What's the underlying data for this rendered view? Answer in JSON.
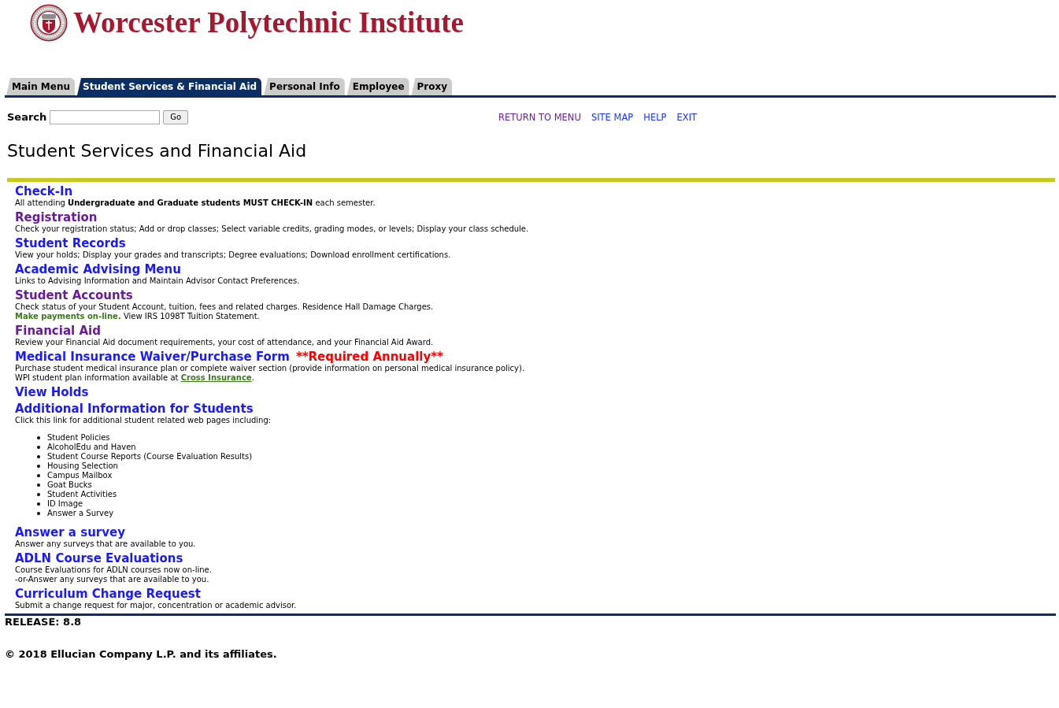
{
  "header": {
    "title": "Worcester Polytechnic Institute"
  },
  "tabs": [
    {
      "label": "Main Menu",
      "selected": false
    },
    {
      "label": "Student Services & Financial Aid",
      "selected": true
    },
    {
      "label": "Personal Info",
      "selected": false
    },
    {
      "label": "Employee",
      "selected": false
    },
    {
      "label": "Proxy",
      "selected": false
    }
  ],
  "search": {
    "label": "Search",
    "button": "Go"
  },
  "top_links": [
    {
      "label": "RETURN TO MENU",
      "visited": true
    },
    {
      "label": "SITE MAP",
      "visited": false
    },
    {
      "label": "HELP",
      "visited": false
    },
    {
      "label": "EXIT",
      "visited": false
    }
  ],
  "page_title": "Student Services and Financial Aid",
  "menu_items": [
    {
      "title": "Check-In",
      "visited": false,
      "lines": [
        [
          {
            "kind": "text",
            "text": "All attending **Undergraduate and Graduate students MUST CHECK-IN** each semester."
          }
        ]
      ]
    },
    {
      "title": "Registration",
      "visited": true,
      "lines": [
        [
          {
            "kind": "text",
            "text": "Check your registration status; Add or drop classes; Select variable credits, grading modes, or levels; Display your class schedule."
          }
        ]
      ]
    },
    {
      "title": "Student Records",
      "visited": false,
      "lines": [
        [
          {
            "kind": "text",
            "text": "View your holds; Display your grades and transcripts; Degree evaluations; Download enrollment certifications."
          }
        ]
      ]
    },
    {
      "title": "Academic Advising Menu",
      "visited": false,
      "lines": [
        [
          {
            "kind": "text",
            "text": "Links to Advising Information and Maintain Advisor Contact Preferences."
          }
        ]
      ]
    },
    {
      "title": "Student Accounts",
      "visited": true,
      "lines": [
        [
          {
            "kind": "text",
            "text": "Check status of your Student Account, tuition, fees and related charges. Residence Hall Damage Charges."
          }
        ],
        [
          {
            "kind": "link",
            "text": "Make payments on-line.",
            "underline": false
          },
          {
            "kind": "text",
            "text": " View IRS 1098T Tuition Statement."
          }
        ]
      ]
    },
    {
      "title": "Financial Aid",
      "visited": true,
      "lines": [
        [
          {
            "kind": "text",
            "text": "Review your Financial Aid document requirements, your cost of attendance, and your Financial Aid Award."
          }
        ]
      ]
    },
    {
      "title": "Medical Insurance Waiver/Purchase Form",
      "note": "**Required Annually**",
      "visited": false,
      "lines": [
        [
          {
            "kind": "text",
            "text": "Purchase student medical insurance plan or complete waiver section (provide information on personal medical insurance policy)."
          }
        ],
        [
          {
            "kind": "text",
            "text": "WPI student plan information available at "
          },
          {
            "kind": "link",
            "text": "Cross Insurance",
            "underline": true
          },
          {
            "kind": "text",
            "text": "."
          }
        ]
      ]
    },
    {
      "title": "View Holds",
      "visited": false
    },
    {
      "title": "Additional Information for Students",
      "visited": false,
      "lines": [
        [
          {
            "kind": "text",
            "text": "Click this link for additional student related web pages including:"
          }
        ]
      ],
      "bullets": [
        "Student Policies",
        "AlcoholEdu and Haven",
        "Student Course Reports (Course Evaluation Results)",
        "Housing Selection",
        "Campus Mailbox",
        "Goat Bucks",
        "Student Activities",
        "ID Image",
        "Answer a Survey"
      ]
    },
    {
      "title": "Answer a survey",
      "visited": false,
      "lines": [
        [
          {
            "kind": "text",
            "text": "Answer any surveys that are available to you."
          }
        ]
      ]
    },
    {
      "title": "ADLN Course Evaluations",
      "visited": false,
      "lines": [
        [
          {
            "kind": "text",
            "text": "Course Evaluations for ADLN courses now on-line."
          }
        ],
        [
          {
            "kind": "text",
            "text": "-or-Answer any surveys that are available to you."
          }
        ]
      ]
    },
    {
      "title": "Curriculum Change Request",
      "visited": false,
      "lines": [
        [
          {
            "kind": "text",
            "text": "Submit a change request for major, concentration or academic advisor."
          }
        ]
      ]
    }
  ],
  "footer": {
    "release": "RELEASE: 8.8",
    "copyright": "© 2018 Ellucian Company L.P. and its affiliates."
  }
}
